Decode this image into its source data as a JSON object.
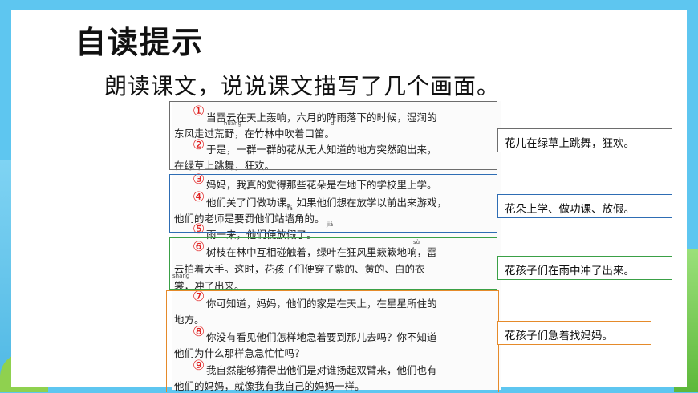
{
  "title": "自读提示",
  "subtitle": "朗读课文，说说课文描写了几个画面。",
  "colors": {
    "group1": "#6d6d6d",
    "group2": "#2e6db4",
    "group3": "#3aa046",
    "group4": "#e58a2a",
    "number": "#e02020"
  },
  "groups": [
    {
      "label": "花儿在绿草上跳舞，狂欢。"
    },
    {
      "label": "花朵上学、做功课、放假。"
    },
    {
      "label": "花孩子们在雨中冲了出来。"
    },
    {
      "label": "花孩子们急着找妈妈。"
    }
  ],
  "numbers": [
    "①",
    "②",
    "③",
    "④",
    "⑤",
    "⑥",
    "⑦",
    "⑧",
    "⑨"
  ],
  "pinyin": [
    "huāng",
    "dí",
    "fá",
    "jiǎ",
    "sù",
    "shang"
  ],
  "lines": [
    "当雷云在天上轰响，六月的阵雨落下的时候，湿润的",
    "东风走过荒野，在竹林中吹着口笛。",
    "于是，一群一群的花从无人知道的地方突然跑出来，",
    "在绿草上跳舞，狂欢。",
    "妈妈，我真的觉得那些花朵是在地下的学校里上学。",
    "他们关了门做功课。如果他们想在放学以前出来游戏，",
    "他们的老师是要罚他们站墙角的。",
    "雨一来，他们便放假了。",
    "树枝在林中互相碰触着，绿叶在狂风里簌簌地响，雷",
    "云拍着大手。这时，花孩子们便穿了紫的、黄的、白的衣",
    "裳，冲了出来。",
    "你可知道，妈妈，他们的家是在天上，在星星所住的",
    "地方。",
    "你没有看见他们怎样地急着要到那儿去吗？你不知道",
    "他们为什么那样急急忙忙吗？",
    "我自然能够猜得出他们是对谁扬起双臂来，他们也有",
    "他们的妈妈，就像我有我自己的妈妈一样。"
  ]
}
